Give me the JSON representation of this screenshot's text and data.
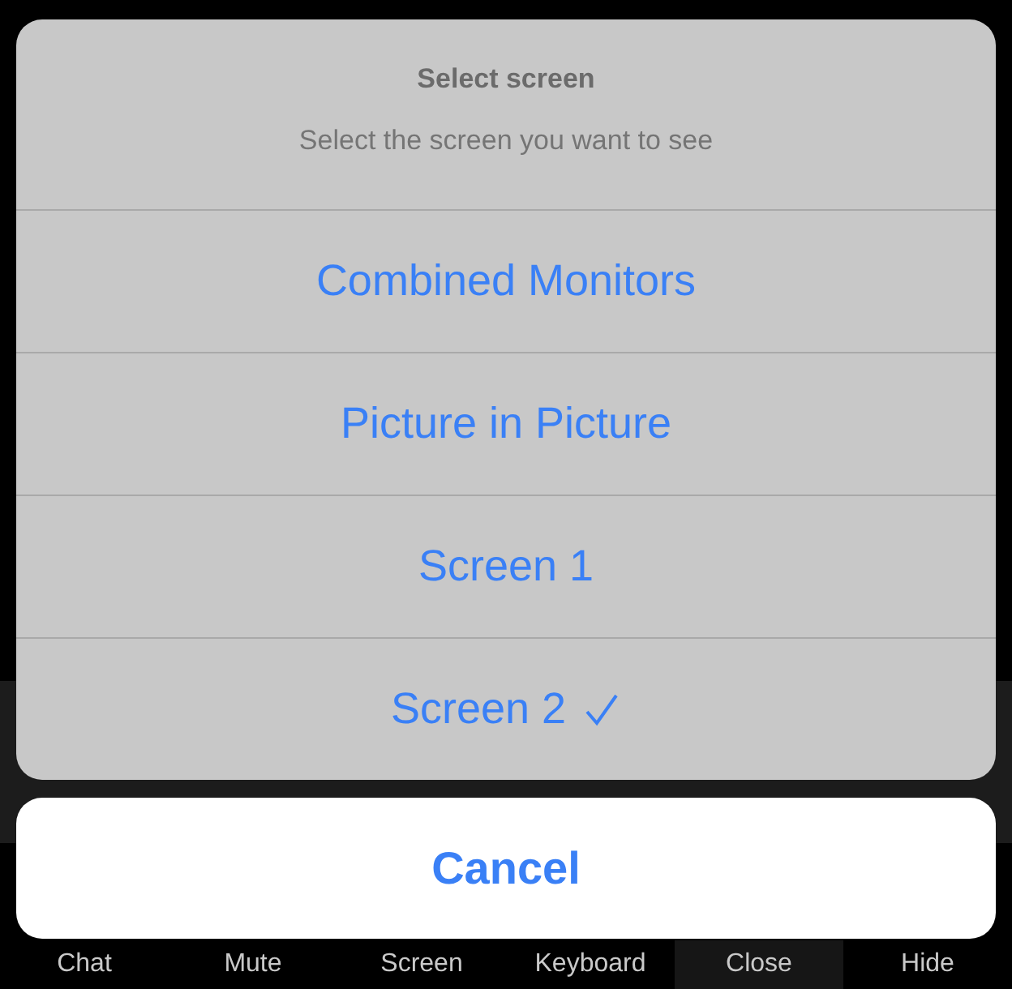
{
  "action_sheet": {
    "title": "Select screen",
    "message": "Select the screen you want to see",
    "options": [
      {
        "label": "Combined Monitors",
        "selected": false
      },
      {
        "label": "Picture in Picture",
        "selected": false
      },
      {
        "label": "Screen 1",
        "selected": false
      },
      {
        "label": "Screen 2",
        "selected": true
      }
    ],
    "cancel": "Cancel"
  },
  "toolbar": [
    {
      "label": "Chat",
      "selected": false
    },
    {
      "label": "Mute",
      "selected": false
    },
    {
      "label": "Screen",
      "selected": false
    },
    {
      "label": "Keyboard",
      "selected": false
    },
    {
      "label": "Close",
      "selected": true
    },
    {
      "label": "Hide",
      "selected": false
    }
  ]
}
